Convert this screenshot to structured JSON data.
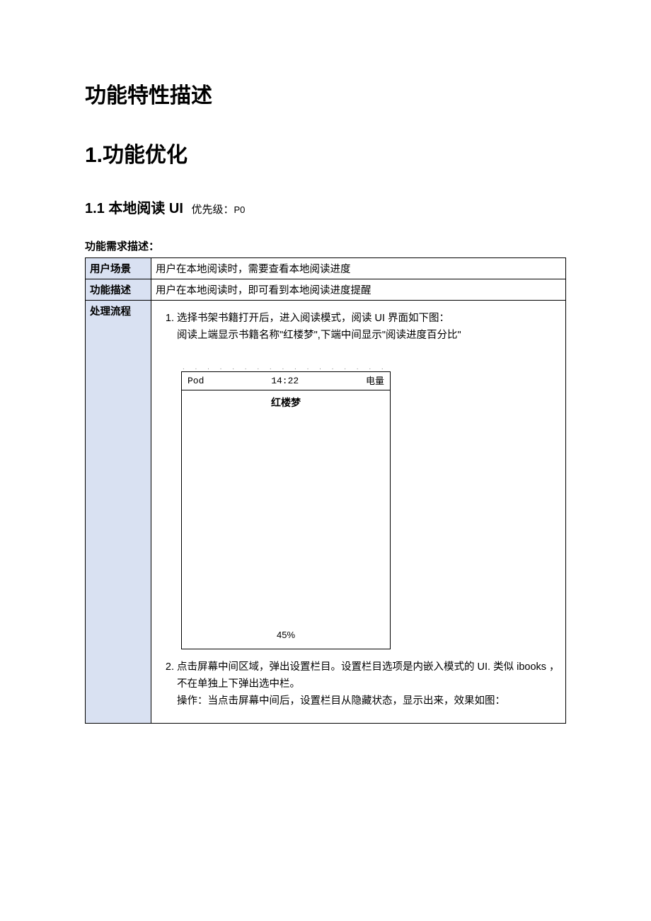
{
  "title_main": "功能特性描述",
  "section1": {
    "heading": "1.功能优化",
    "sub": {
      "heading_prefix": "1.1 本地阅读 UI",
      "priority_label": "优先级：",
      "priority_value": "P0"
    }
  },
  "req_desc_label": "功能需求描述：",
  "table": {
    "row_scenario_label": "用户场景",
    "row_scenario_value": "用户在本地阅读时，需要查看本地阅读进度",
    "row_func_label": "功能描述",
    "row_func_value": "用户在本地阅读时，即可看到本地阅读进度提醒",
    "row_flow_label": "处理流程",
    "flow": {
      "item1_line1": "选择书架书籍打开后，进入阅读模式，阅读 UI 界面如下图：",
      "item1_line2": "阅读上端显示书籍名称\"红楼梦\",下端中间显示\"阅读进度百分比\"",
      "item2_line1": "点击屏幕中间区域，弹出设置栏目。设置栏目选项是内嵌入模式的 UI. 类似 ibooks ，不在单独上下弹出选中栏。",
      "item2_line2": "操作：当点击屏幕中间后，设置栏目从隐藏状态，显示出来，效果如图："
    }
  },
  "mock": {
    "status_left": "Pod",
    "status_time": "14:22",
    "status_right": "电量",
    "book_title": "红楼梦",
    "progress": "45%"
  }
}
